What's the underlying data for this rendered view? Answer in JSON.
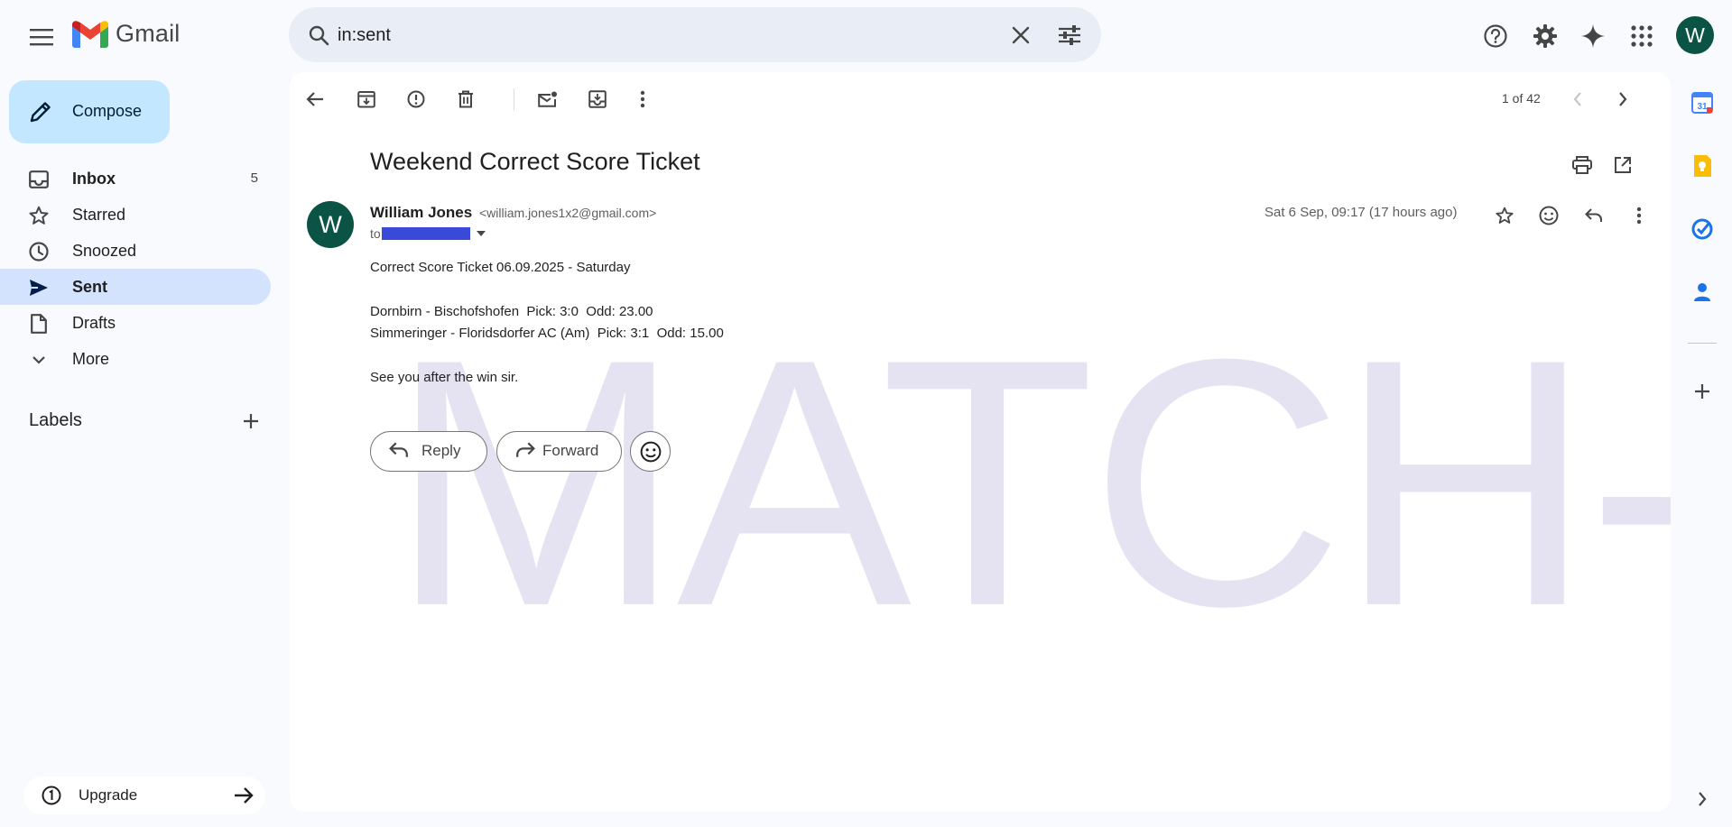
{
  "app": {
    "name": "Gmail"
  },
  "search": {
    "value": "in:sent"
  },
  "compose": {
    "label": "Compose"
  },
  "nav": [
    {
      "label": "Inbox",
      "count": "5"
    },
    {
      "label": "Starred"
    },
    {
      "label": "Snoozed"
    },
    {
      "label": "Sent"
    },
    {
      "label": "Drafts"
    },
    {
      "label": "More"
    }
  ],
  "labels": {
    "title": "Labels"
  },
  "upgrade": {
    "label": "Upgrade"
  },
  "account": {
    "initial": "W"
  },
  "toolbar": {
    "pager": "1 of 42"
  },
  "email": {
    "subject": "Weekend Correct Score Ticket",
    "sender_name": "William Jones",
    "sender_email": "<william.jones1x2@gmail.com>",
    "sender_initial": "W",
    "to_prefix": "to",
    "date": "Sat 6 Sep, 09:17 (17 hours ago)",
    "body": [
      "Correct Score Ticket 06.09.2025 - Saturday",
      "Dornbirn - Bischofshofen  Pick: 3:0  Odd: 23.00",
      "Simmeringer - Floridsdorfer AC (Am)  Pick: 3:1  Odd: 15.00",
      "See you after the win sir."
    ],
    "reply_label": "Reply",
    "forward_label": "Forward"
  },
  "watermark": "MATCH-WIN",
  "side_panel": {
    "calendar_day": "31"
  },
  "colors": {
    "accent": "#c2e7ff",
    "nav_active": "#d3e3fd",
    "avatar": "#0b5345",
    "watermark": "#e5e3f1"
  }
}
